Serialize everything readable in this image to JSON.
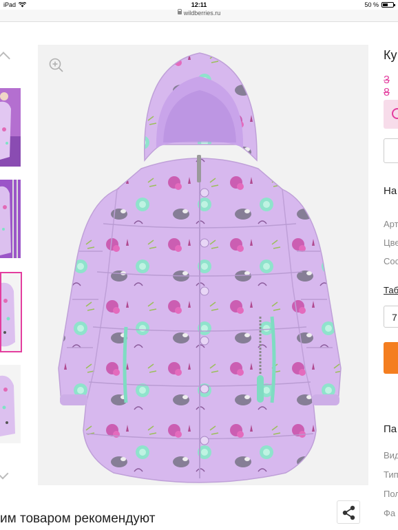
{
  "status_bar": {
    "device": "iPad",
    "time": "12:11",
    "battery": "50 %",
    "battery_level": 0.5
  },
  "browser": {
    "url": "wildberries.ru"
  },
  "gallery": {
    "thumbnail_count": 4,
    "active_thumbnail_index": 2,
    "main_image_alt": "lilac printed quilted winter coat with hood"
  },
  "product": {
    "title_fragment": "Ку",
    "price_fragment": "3 8",
    "section_fragment": "На",
    "attr_labels": [
      "Арт",
      "Цве",
      "Сос"
    ],
    "size_table_link": "Таб",
    "size_select_value": "7",
    "params_heading": "Па",
    "param_labels": [
      "Вид",
      "Тип",
      "Пол",
      "Фа"
    ]
  },
  "recommendations": {
    "heading": "им товаром рекомендуют"
  },
  "colors": {
    "accent_pink": "#e33d9e",
    "accent_orange": "#f47e20",
    "coat_lilac": "#d7b8ee"
  },
  "icons": {
    "zoom": "zoom-in-icon",
    "share": "share-icon",
    "timer": "clock-icon"
  }
}
